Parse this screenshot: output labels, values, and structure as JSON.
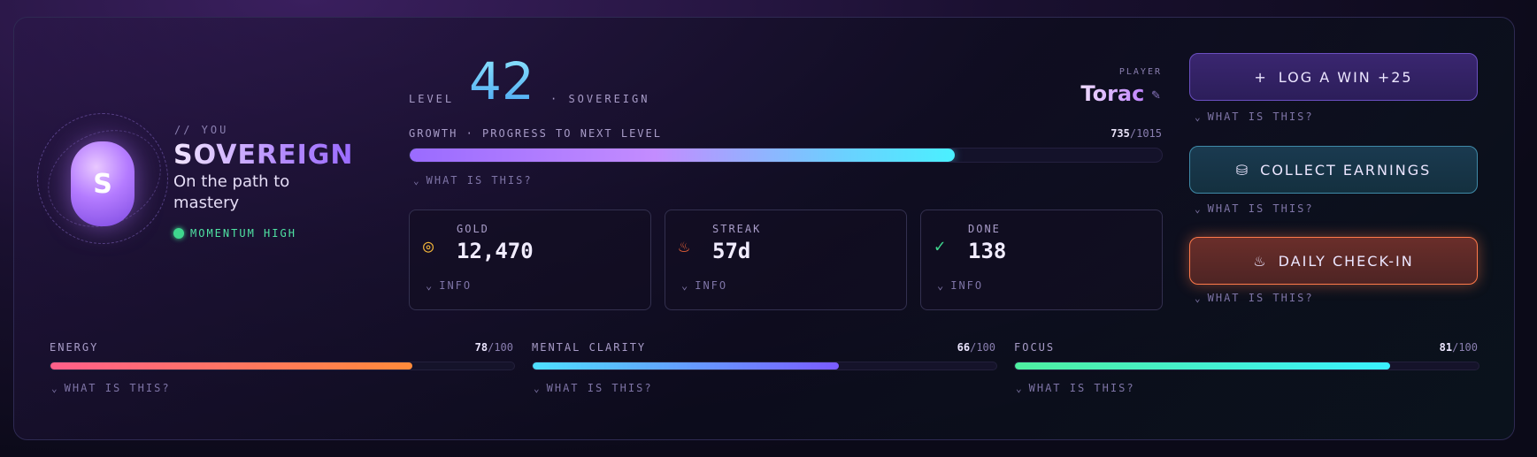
{
  "profile": {
    "you_label": "// YOU",
    "title": "SOVEREIGN",
    "tagline": "On the path to mastery",
    "avatar_letter": "S",
    "momentum": "MOMENTUM HIGH"
  },
  "level": {
    "label": "LEVEL",
    "number": "42",
    "rank": "· SOVEREIGN"
  },
  "player": {
    "label": "PLAYER",
    "name": "Torac"
  },
  "growth": {
    "label": "GROWTH · PROGRESS TO NEXT LEVEL",
    "current": "735",
    "max": "/1015",
    "current_value": 735,
    "max_value": 1015,
    "help": "WHAT IS THIS?"
  },
  "stats": [
    {
      "label": "GOLD",
      "value": "12,470",
      "info": "INFO",
      "icon": "coins-icon",
      "color": "#f2b53a"
    },
    {
      "label": "STREAK",
      "value": "57d",
      "info": "INFO",
      "icon": "flame-icon",
      "color": "#ff6a3a"
    },
    {
      "label": "DONE",
      "value": "138",
      "info": "INFO",
      "icon": "check-circle-icon",
      "color": "#3fd68e"
    }
  ],
  "actions": {
    "log_win": "LOG A WIN +25",
    "collect": "COLLECT EARNINGS",
    "daily": "DAILY CHECK-IN",
    "help": "WHAT IS THIS?"
  },
  "meters": [
    {
      "label": "ENERGY",
      "current": "78",
      "max": "/100",
      "value": 78,
      "colors": [
        "#ff5f8a",
        "#ff8a3a"
      ]
    },
    {
      "label": "MENTAL CLARITY",
      "current": "66",
      "max": "/100",
      "value": 66,
      "colors": [
        "#4ee0ff",
        "#7a5bff"
      ]
    },
    {
      "label": "FOCUS",
      "current": "81",
      "max": "/100",
      "value": 81,
      "colors": [
        "#4ef0a0",
        "#3af0ff"
      ]
    }
  ],
  "meter_help": "WHAT IS THIS?"
}
